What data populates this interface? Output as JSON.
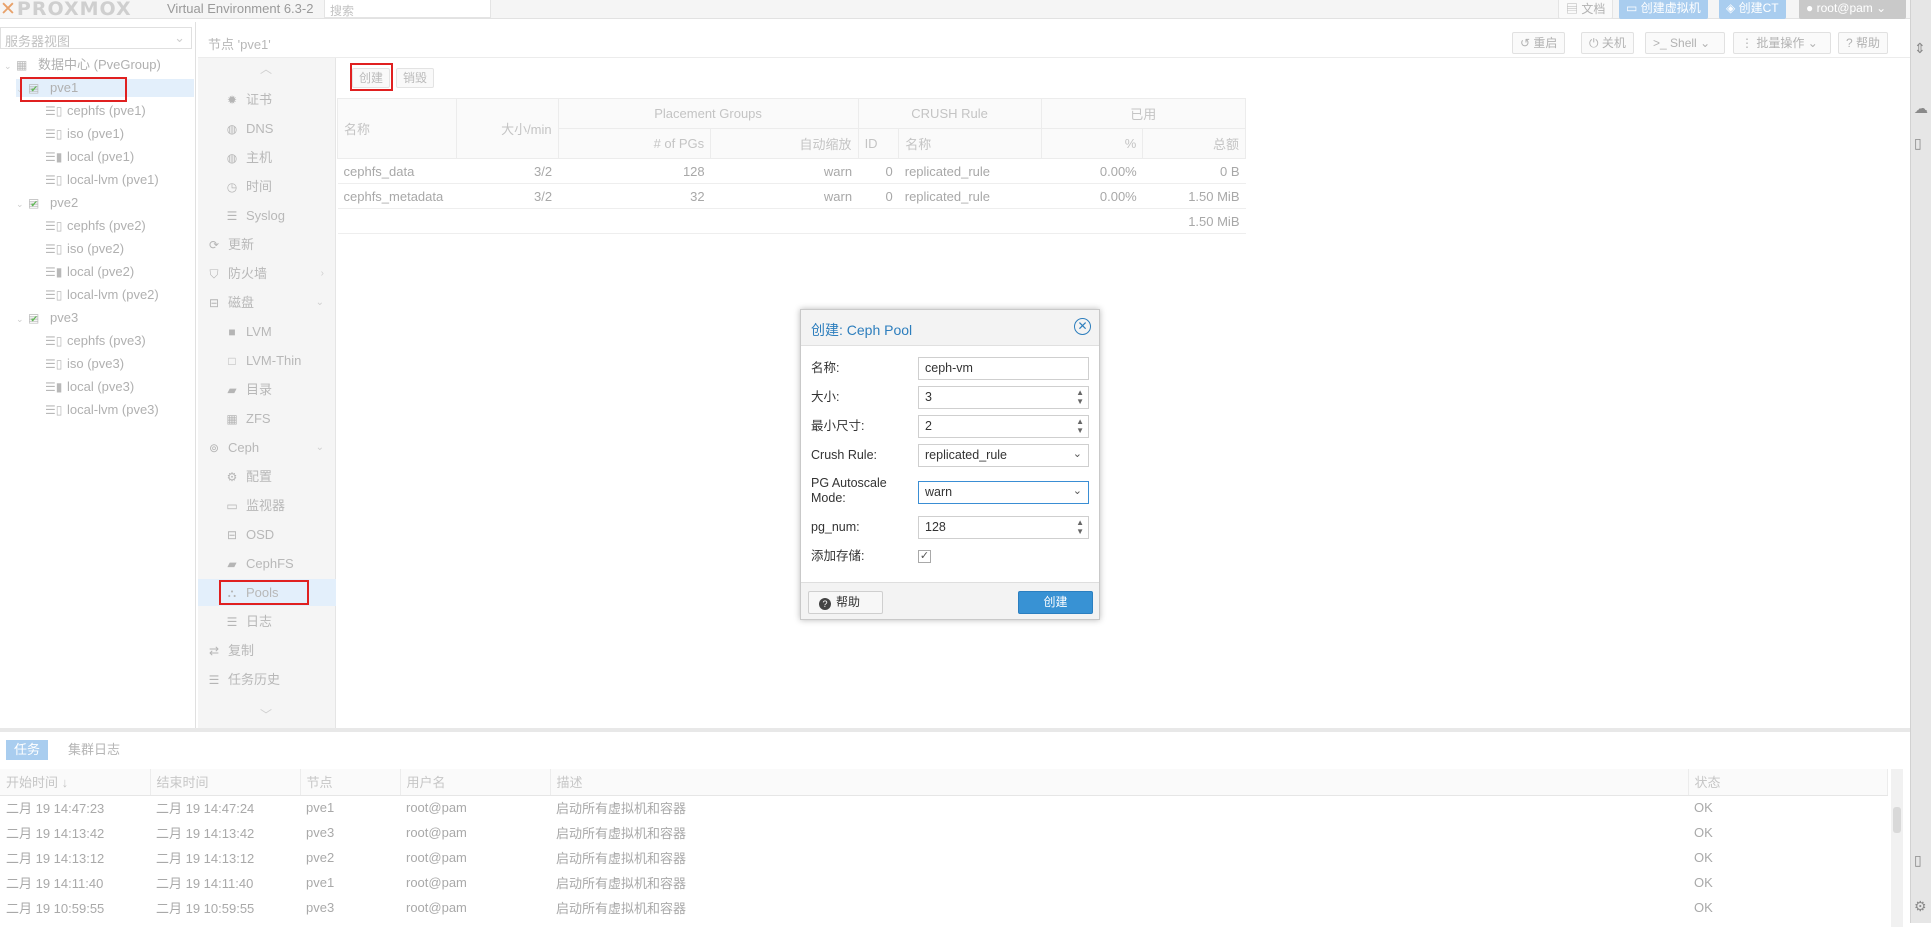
{
  "app": {
    "logo": "PROXMOX",
    "version": "Virtual Environment 6.3-2",
    "search_placeholder": "搜索",
    "buttons": {
      "docs": "文档",
      "create_vm": "创建虚拟机",
      "create_ct": "创建CT",
      "user": "root@pam"
    }
  },
  "sidebar": {
    "view": "服务器视图",
    "datacenter": "数据中心 (PveGroup)",
    "nodes": [
      {
        "name": "pve1",
        "storages": [
          "cephfs (pve1)",
          "iso (pve1)",
          "local (pve1)",
          "local-lvm (pve1)"
        ]
      },
      {
        "name": "pve2",
        "storages": [
          "cephfs (pve2)",
          "iso (pve2)",
          "local (pve2)",
          "local-lvm (pve2)"
        ]
      },
      {
        "name": "pve3",
        "storages": [
          "cephfs (pve3)",
          "iso (pve3)",
          "local (pve3)",
          "local-lvm (pve3)"
        ]
      }
    ]
  },
  "header": {
    "breadcrumb": "节点 'pve1'",
    "buttons": {
      "reboot": "重启",
      "shutdown": "关机",
      "shell": "Shell",
      "bulk": "批量操作",
      "help": "帮助"
    }
  },
  "menu": {
    "items": [
      "证书",
      "DNS",
      "主机",
      "时间",
      "Syslog",
      "更新",
      "防火墙",
      "磁盘",
      "LVM",
      "LVM-Thin",
      "目录",
      "ZFS",
      "Ceph",
      "配置",
      "监视器",
      "OSD",
      "CephFS",
      "Pools",
      "日志",
      "复制",
      "任务历史"
    ]
  },
  "pools": {
    "toolbar": {
      "create": "创建",
      "destroy": "销毁"
    },
    "groups": {
      "pg": "Placement Groups",
      "crush": "CRUSH Rule",
      "used": "已用"
    },
    "columns": {
      "name": "名称",
      "size": "大小/min",
      "num_pgs": "# of PGs",
      "autoscale": "自动缩放",
      "id": "ID",
      "rule_name": "名称",
      "pct": "%",
      "total": "总额"
    },
    "rows": [
      {
        "name": "cephfs_data",
        "size": "3/2",
        "pgs": "128",
        "autoscale": "warn",
        "id": "0",
        "rule": "replicated_rule",
        "pct": "0.00%",
        "total": "0 B"
      },
      {
        "name": "cephfs_metadata",
        "size": "3/2",
        "pgs": "32",
        "autoscale": "warn",
        "id": "0",
        "rule": "replicated_rule",
        "pct": "0.00%",
        "total": "1.50 MiB"
      }
    ],
    "sum_total": "1.50 MiB"
  },
  "dialog": {
    "title": "创建: Ceph Pool",
    "labels": {
      "name": "名称:",
      "size": "大小:",
      "min_size": "最小尺寸:",
      "crush": "Crush Rule:",
      "autoscale_1": "PG Autoscale",
      "autoscale_2": "Mode:",
      "pg_num": "pg_num:",
      "add_storage": "添加存储:"
    },
    "values": {
      "name": "ceph-vm",
      "size": "3",
      "min_size": "2",
      "crush": "replicated_rule",
      "autoscale": "warn",
      "pg_num": "128"
    },
    "help": "帮助",
    "create": "创建"
  },
  "tasks": {
    "tabs": {
      "tasks": "任务",
      "cluster_log": "集群日志"
    },
    "columns": {
      "start": "开始时间 ↓",
      "end": "结束时间",
      "node": "节点",
      "user": "用户名",
      "desc": "描述",
      "status": "状态"
    },
    "rows": [
      {
        "start": "二月 19 14:47:23",
        "end": "二月 19 14:47:24",
        "node": "pve1",
        "user": "root@pam",
        "desc": "启动所有虚拟机和容器",
        "status": "OK"
      },
      {
        "start": "二月 19 14:13:42",
        "end": "二月 19 14:13:42",
        "node": "pve3",
        "user": "root@pam",
        "desc": "启动所有虚拟机和容器",
        "status": "OK"
      },
      {
        "start": "二月 19 14:13:12",
        "end": "二月 19 14:13:12",
        "node": "pve2",
        "user": "root@pam",
        "desc": "启动所有虚拟机和容器",
        "status": "OK"
      },
      {
        "start": "二月 19 14:11:40",
        "end": "二月 19 14:11:40",
        "node": "pve1",
        "user": "root@pam",
        "desc": "启动所有虚拟机和容器",
        "status": "OK"
      },
      {
        "start": "二月 19 10:59:55",
        "end": "二月 19 10:59:55",
        "node": "pve3",
        "user": "root@pam",
        "desc": "启动所有虚拟机和容器",
        "status": "OK"
      }
    ]
  },
  "colors": {
    "accent": "#3892d4",
    "highlight": "#e02020"
  }
}
